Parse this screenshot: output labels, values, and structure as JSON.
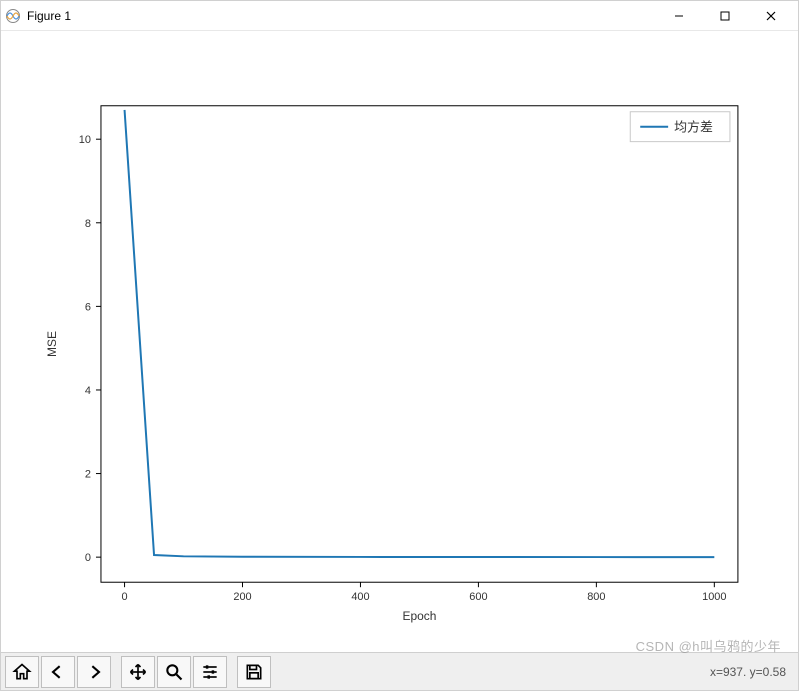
{
  "window": {
    "title": "Figure 1"
  },
  "win_controls": {
    "min": "—",
    "max": "▢",
    "close": "✕"
  },
  "chart_data": {
    "type": "line",
    "x": [
      0,
      50,
      100,
      200,
      400,
      600,
      800,
      1000
    ],
    "y": [
      10.7,
      0.05,
      0.02,
      0.01,
      0.005,
      0.003,
      0.002,
      0.001
    ],
    "series": [
      {
        "name": "均方差",
        "color": "#1f77b4"
      }
    ],
    "xlabel": "Epoch",
    "ylabel": "MSE",
    "xlim": [
      -40,
      1040
    ],
    "ylim": [
      -0.6,
      10.8
    ],
    "xticks": [
      0,
      200,
      400,
      600,
      800,
      1000
    ],
    "yticks": [
      0,
      2,
      4,
      6,
      8,
      10
    ],
    "legend_position": "upper right"
  },
  "toolbar": {
    "home": "home-icon",
    "back": "back-icon",
    "forward": "forward-icon",
    "pan": "pan-icon",
    "zoom": "zoom-icon",
    "configure": "configure-icon",
    "save": "save-icon",
    "coords": "x=937. y=0.58"
  },
  "watermark": "CSDN @h叫乌鸦的少年"
}
